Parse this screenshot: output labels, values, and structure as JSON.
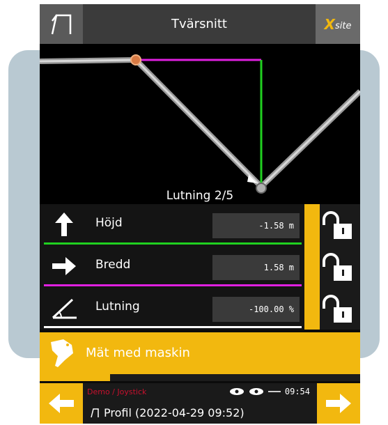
{
  "header": {
    "title": "Tvärsnitt",
    "logo_x": "X",
    "logo_site": "site",
    "left_icon": "bucket-profile-icon"
  },
  "canvas": {
    "label": "Lutning 2/5"
  },
  "rows": [
    {
      "icon": "arrow-up-icon",
      "label": "Höjd",
      "value": "-1.58 m",
      "color": "#20d020"
    },
    {
      "icon": "arrow-right-icon",
      "label": "Bredd",
      "value": "1.58 m",
      "color": "#e020e0"
    },
    {
      "icon": "slope-angle-icon",
      "label": "Lutning",
      "value": "-100.00 %",
      "color": "#ffffff"
    }
  ],
  "measure": {
    "label": "Mät med maskin",
    "icon": "bucket-icon"
  },
  "progress": {
    "fraction": 0.22
  },
  "footer": {
    "mode": "Demo / Joystick",
    "time": "09:54",
    "profile": "Profil (2022-04-29 09:52)",
    "prev_icon": "arrow-left-icon",
    "next_icon": "arrow-right-icon"
  },
  "colors": {
    "accent": "#f2b80f",
    "height_line": "#20d020",
    "width_line": "#e020e0"
  }
}
